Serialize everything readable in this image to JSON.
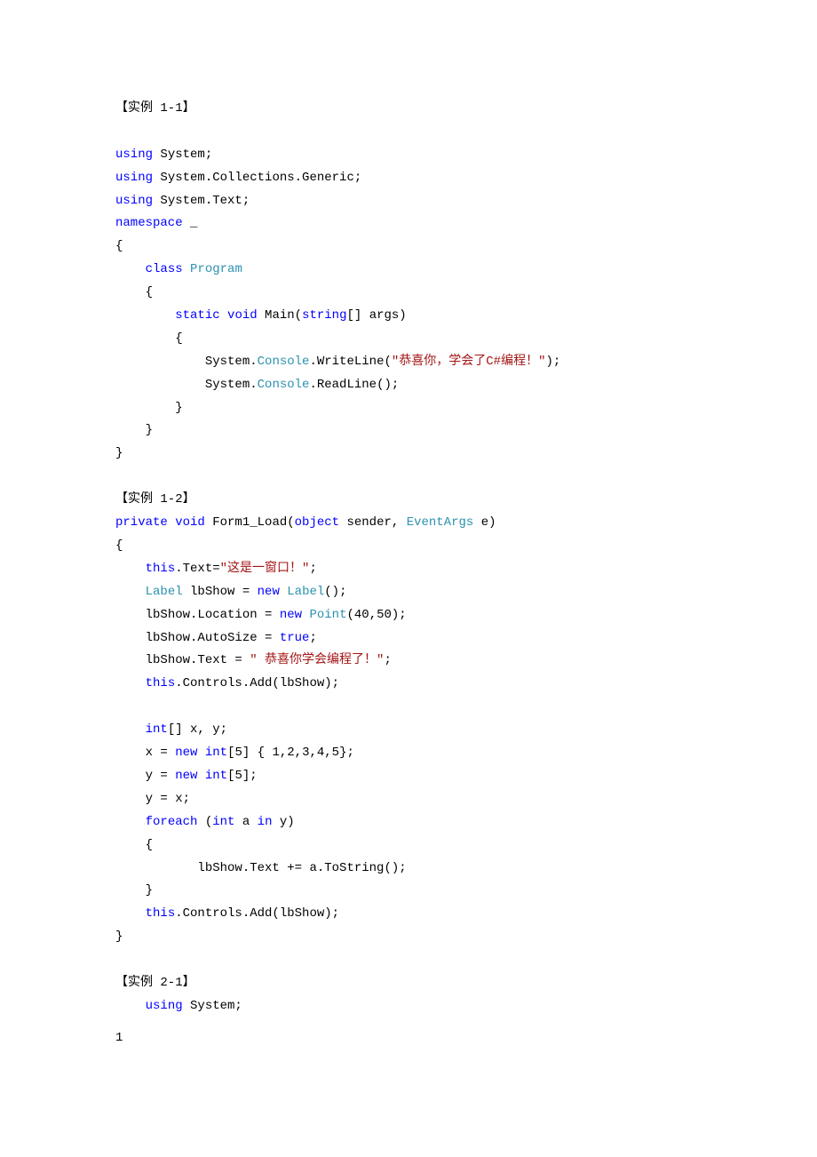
{
  "ex1": {
    "title": "【实例 1-1】",
    "using": "using",
    "system": " System;",
    "system_coll": " System.Collections.Generic;",
    "system_text": " System.Text;",
    "namespace": "namespace",
    "underscore": " _",
    "obrace": "{",
    "cbrace": "}",
    "class_kw": "class",
    "program": "Program",
    "static_kw": "static",
    "void_kw": "void",
    "main": " Main(",
    "string_kw": "string",
    "args": "[] args)",
    "console_pre": "System.",
    "console": "Console",
    "writeline": ".WriteLine(",
    "writeline_str": "\"恭喜你，学会了C#编程！\"",
    "writeline_end": ");",
    "readline": ".ReadLine();"
  },
  "ex2": {
    "title": "【实例 1-2】",
    "private_kw": "private",
    "void_kw": "void",
    "form_load": " Form1_Load(",
    "object_kw": "object",
    "sender": " sender, ",
    "eventargs": "EventArgs",
    "e": " e)",
    "obrace": "{",
    "cbrace": "}",
    "this_kw": "this",
    "text_eq": ".Text=",
    "win_str": "\"这是一窗口！\"",
    "semicolon": ";",
    "label_type": "Label",
    "lbshow_decl": " lbShow = ",
    "new_kw": "new",
    "label_call": "Label",
    "paren_end": "();",
    "loc": "lbShow.Location = ",
    "point": "Point",
    "point_args": "(40,50);",
    "autosize": "lbShow.AutoSize = ",
    "true_kw": "true",
    "lbtext": "lbShow.Text = ",
    "congrats_str": "\" 恭喜你学会编程了！\"",
    "controls_add": ".Controls.Add(lbShow);",
    "int_kw": "int",
    "xy_decl": "[] x, y;",
    "x_eq": "x = ",
    "int5": "int",
    "bracket5": "[5] { 1,2,3,4,5};",
    "y_eq": "y = ",
    "bracket5b": "[5];",
    "y_x": "y = x;",
    "foreach_kw": "foreach",
    "foreach_open": " (",
    "a_in": " a ",
    "in_kw": "in",
    "y_paren": " y)",
    "lbshow_append": "lbShow.Text += a.ToString();"
  },
  "ex3": {
    "title": "【实例 2-1】",
    "using": "using",
    "system": " System;"
  },
  "page_num": "1"
}
